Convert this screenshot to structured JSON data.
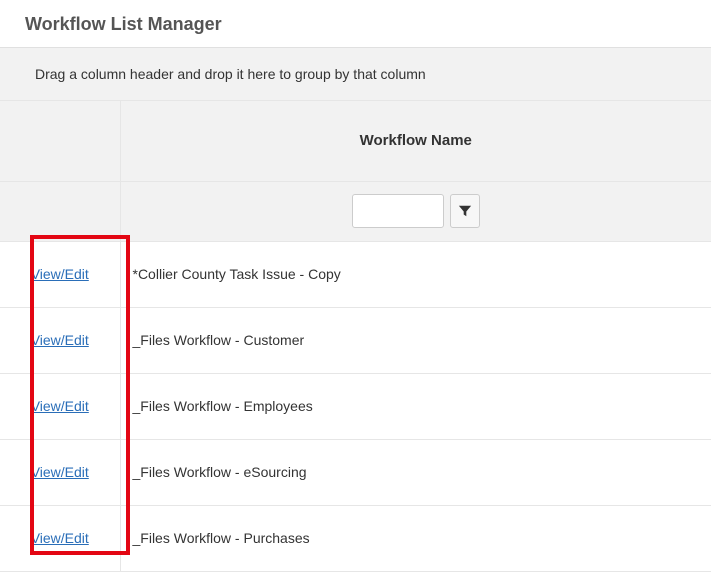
{
  "page": {
    "title": "Workflow List Manager"
  },
  "group_panel": {
    "text": "Drag a column header and drop it here to group by that column"
  },
  "columns": {
    "action": "",
    "name": "Workflow Name"
  },
  "filter": {
    "value": ""
  },
  "links": {
    "view_edit": "View/Edit"
  },
  "rows": [
    {
      "name": "*Collier County Task Issue - Copy"
    },
    {
      "name": "_Files Workflow - Customer"
    },
    {
      "name": "_Files Workflow - Employees"
    },
    {
      "name": "_Files Workflow - eSourcing"
    },
    {
      "name": "_Files Workflow - Purchases"
    }
  ]
}
